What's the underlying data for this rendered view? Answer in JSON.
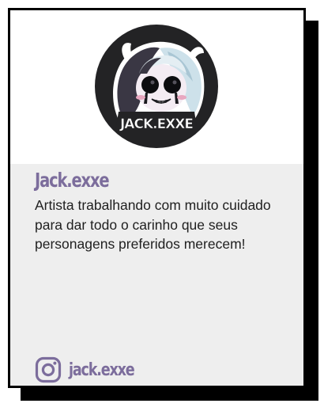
{
  "profile": {
    "avatar_caption": "JACK.EXXE",
    "name": "Jack.exxe",
    "bio": "Artista trabalhando com muito cuidado para dar todo o carinho que seus personagens preferidos merecem!"
  },
  "social": {
    "icon": "instagram-icon",
    "handle": "jack.exxe"
  },
  "colors": {
    "accent": "#7c6d9c",
    "panel_bg": "#eeeeee",
    "border": "#000000",
    "avatar_bg": "#232325"
  }
}
